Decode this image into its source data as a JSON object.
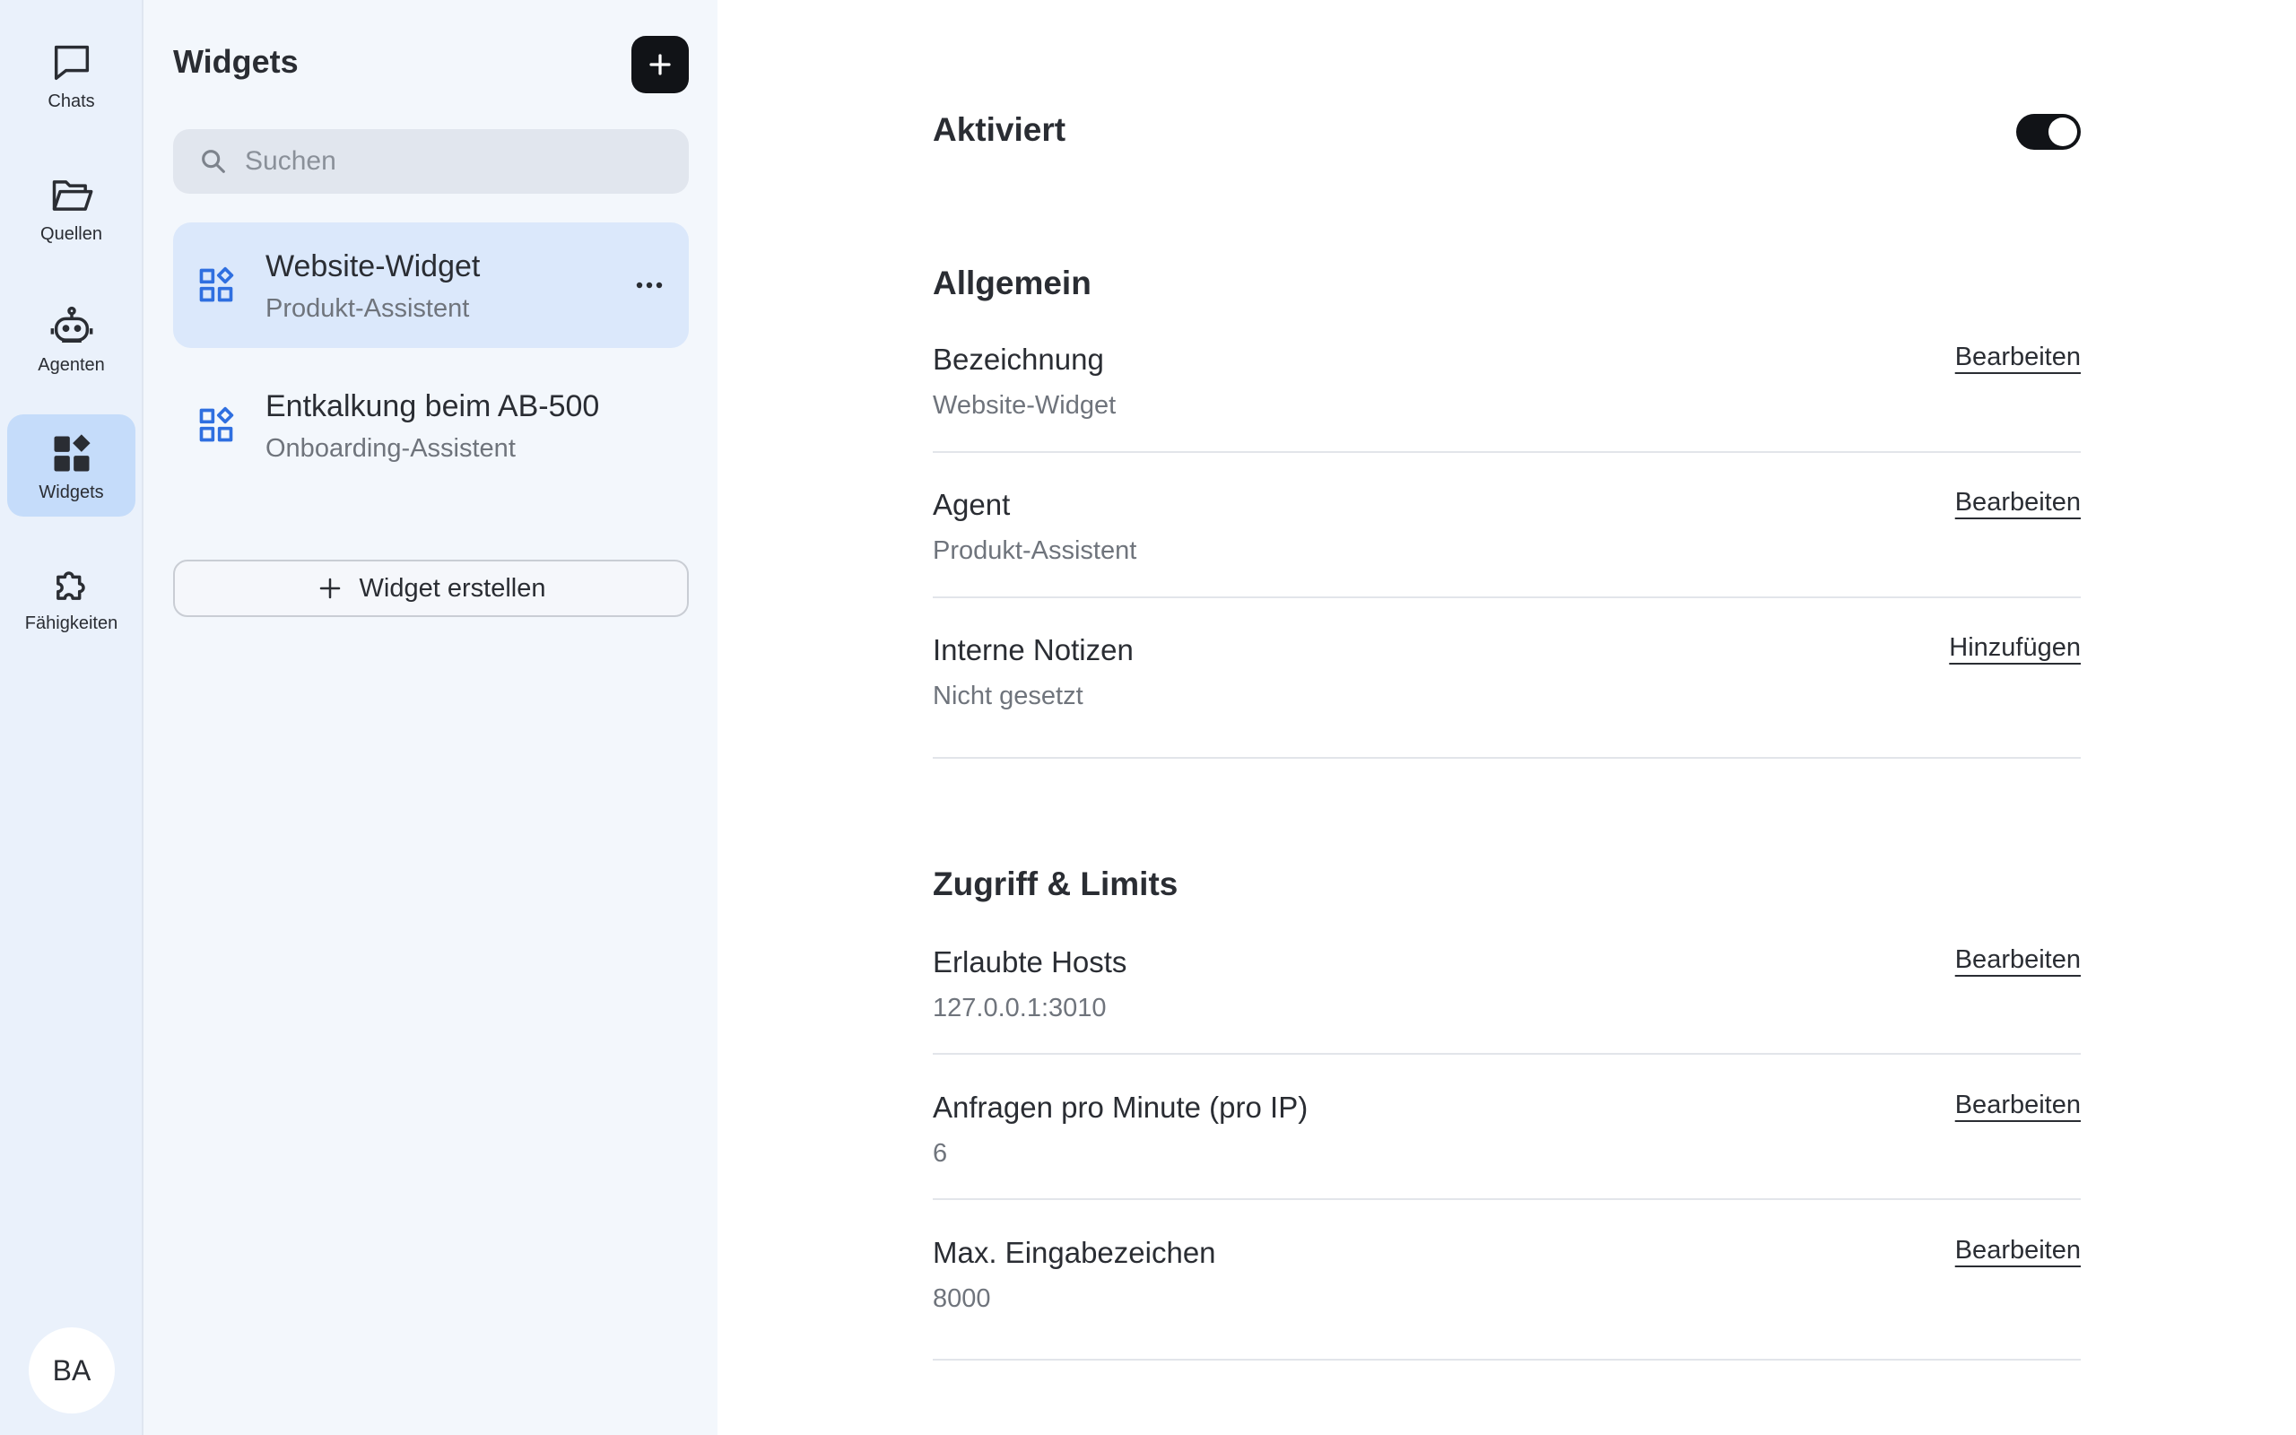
{
  "nav": {
    "items": [
      {
        "label": "Chats",
        "icon": "chat-bubble-icon"
      },
      {
        "label": "Quellen",
        "icon": "folder-open-icon"
      },
      {
        "label": "Agenten",
        "icon": "robot-icon"
      },
      {
        "label": "Widgets",
        "icon": "widgets-icon"
      },
      {
        "label": "Fähigkeiten",
        "icon": "puzzle-icon"
      }
    ],
    "active": "Widgets",
    "avatar_initials": "BA"
  },
  "list": {
    "title": "Widgets",
    "search_placeholder": "Suchen",
    "items": [
      {
        "name": "Website-Widget",
        "subtitle": "Produkt-Assistent",
        "selected": true
      },
      {
        "name": "Entkalkung beim AB-500",
        "subtitle": "Onboarding-Assistent",
        "selected": false
      }
    ],
    "create_label": "Widget erstellen"
  },
  "detail": {
    "enabled_label": "Aktiviert",
    "enabled": true,
    "general": {
      "title": "Allgemein",
      "rows": [
        {
          "label": "Bezeichnung",
          "value": "Website-Widget",
          "action": "Bearbeiten"
        },
        {
          "label": "Agent",
          "value": "Produkt-Assistent",
          "action": "Bearbeiten"
        },
        {
          "label": "Interne Notizen",
          "value": "Nicht gesetzt",
          "action": "Hinzufügen"
        }
      ]
    },
    "access": {
      "title": "Zugriff & Limits",
      "rows": [
        {
          "label": "Erlaubte Hosts",
          "value": "127.0.0.1:3010",
          "action": "Bearbeiten"
        },
        {
          "label": "Anfragen pro Minute (pro IP)",
          "value": "6",
          "action": "Bearbeiten"
        },
        {
          "label": "Max. Eingabezeichen",
          "value": "8000",
          "action": "Bearbeiten"
        }
      ]
    }
  },
  "colors": {
    "accent_blue": "#2f6fe0",
    "selected_bg": "#dbe8fb",
    "rail_active_bg": "#c5dcfa",
    "dark": "#111317"
  }
}
